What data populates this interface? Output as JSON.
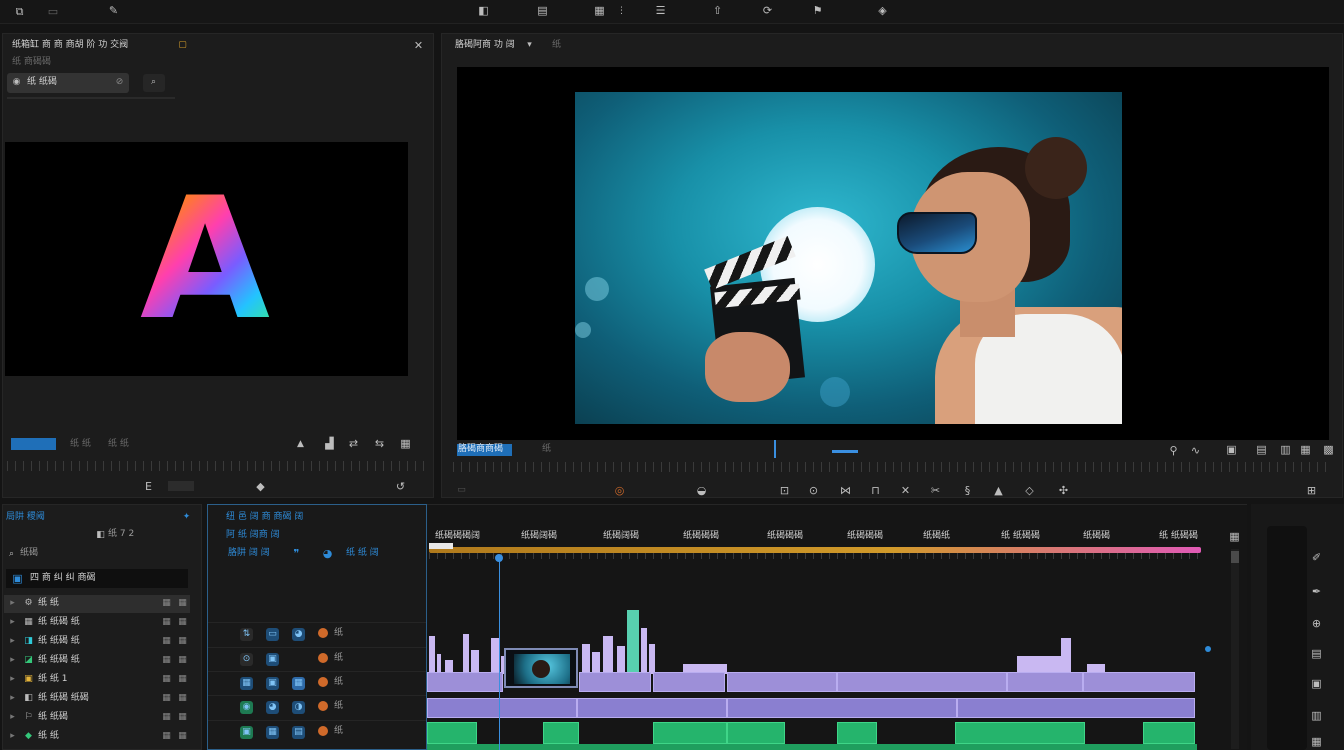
{
  "source_panel": {
    "title": "纸箱缸 商 商 商胡 阶 功 交阀",
    "subtitle": "纸 商碣碣",
    "search_value": "纸 纸碣",
    "footer_timecode": "纸 纸",
    "footer_duration": "纸 纸"
  },
  "program_panel": {
    "title": "胳碣阿商 功 阔",
    "tab_extra": "纸",
    "timecode": "胳碣商商碣",
    "timecode2": "纸"
  },
  "project_panel": {
    "title": "局阱 稷阈",
    "count": "纸 7 2",
    "search_label": "纸碣",
    "folder_label": "四 商 纠 纠 商碣",
    "items": [
      {
        "label": "纸 纸"
      },
      {
        "label": "纸 纸碣 纸"
      },
      {
        "label": "纸 纸碣 纸"
      },
      {
        "label": "纸 纸碣 纸"
      },
      {
        "label": "纸 纸 1"
      },
      {
        "label": "纸 纸碣 纸碣"
      },
      {
        "label": "纸 纸碣"
      },
      {
        "label": "纸 纸"
      }
    ]
  },
  "tracks_panel": {
    "title": "纽 邑 阔 商 商碣 阔",
    "subtitle": "阿 纸 阔商 阔",
    "row3": "胳阱 阔 阔",
    "row3_tail": "纸 纸 阔",
    "tracks": [
      {
        "label": "纸"
      },
      {
        "label": "纸"
      },
      {
        "label": "纸"
      },
      {
        "label": "纸"
      },
      {
        "label": "纸"
      }
    ]
  },
  "timeline": {
    "ruler_labels": [
      "纸碣碣碣阔",
      "纸碣阔碣",
      "纸碣阔碣",
      "纸碣碣碣",
      "纸碣碣碣",
      "纸碣碣碣",
      "纸碣纸",
      "纸 纸碣碣",
      "纸碣碣",
      "纸 纸碣碣"
    ]
  },
  "colors": {
    "accent_blue": "#2e8bd8",
    "audio_green": "#25b46c",
    "video_purple": "#9d8fd8",
    "time_bar_orange": "#d19a2a",
    "time_bar_pink": "#e05ab6"
  }
}
